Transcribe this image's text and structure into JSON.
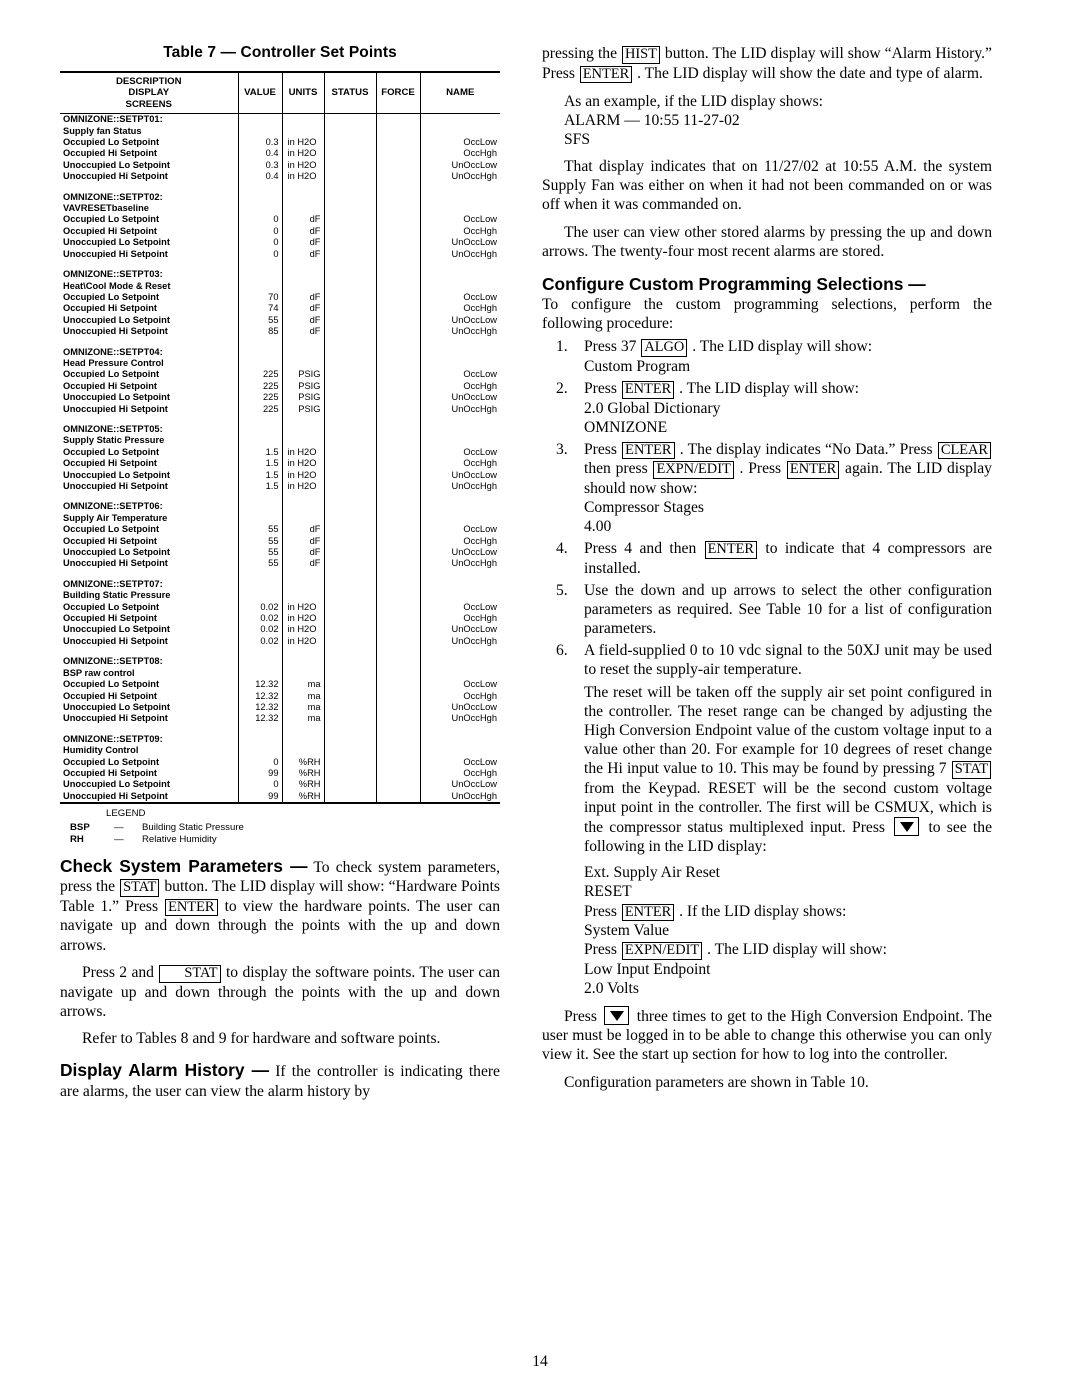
{
  "page": {
    "number": "14"
  },
  "table": {
    "title": "Table 7 — Controller Set Points",
    "headers": {
      "description": "DESCRIPTION\nDISPLAY\nSCREENS",
      "desc_line1": "DESCRIPTION",
      "desc_line2": "DISPLAY",
      "desc_line3": "SCREENS",
      "value": "VALUE",
      "units": "UNITS",
      "status": "STATUS",
      "force": "FORCE",
      "name": "NAME"
    },
    "groups": [
      {
        "id": "OMNIZONE::SETPT01:",
        "subtitle": "Supply fan Status",
        "rows": [
          {
            "desc": "Occupied Lo Setpoint",
            "value": "0.3",
            "units": "in H2O",
            "status": "",
            "force": "",
            "name": "OccLow"
          },
          {
            "desc": "Occupied Hi Setpoint",
            "value": "0.4",
            "units": "in H2O",
            "status": "",
            "force": "",
            "name": "OccHgh"
          },
          {
            "desc": "Unoccupied Lo Setpoint",
            "value": "0.3",
            "units": "in H2O",
            "status": "",
            "force": "",
            "name": "UnOccLow"
          },
          {
            "desc": "Unoccupied Hi Setpoint",
            "value": "0.4",
            "units": "in H2O",
            "status": "",
            "force": "",
            "name": "UnOccHgh"
          }
        ]
      },
      {
        "id": "OMNIZONE::SETPT02:",
        "subtitle": "VAVRESETbaseline",
        "rows": [
          {
            "desc": "Occupied Lo Setpoint",
            "value": "0",
            "units": "dF",
            "status": "",
            "force": "",
            "name": "OccLow"
          },
          {
            "desc": "Occupied Hi Setpoint",
            "value": "0",
            "units": "dF",
            "status": "",
            "force": "",
            "name": "OccHgh"
          },
          {
            "desc": "Unoccupied Lo Setpoint",
            "value": "0",
            "units": "dF",
            "status": "",
            "force": "",
            "name": "UnOccLow"
          },
          {
            "desc": "Unoccupied Hi Setpoint",
            "value": "0",
            "units": "dF",
            "status": "",
            "force": "",
            "name": "UnOccHgh"
          }
        ]
      },
      {
        "id": "OMNIZONE::SETPT03:",
        "subtitle": "Heat\\Cool Mode & Reset",
        "rows": [
          {
            "desc": "Occupied Lo Setpoint",
            "value": "70",
            "units": "dF",
            "status": "",
            "force": "",
            "name": "OccLow"
          },
          {
            "desc": "Occupied Hi Setpoint",
            "value": "74",
            "units": "dF",
            "status": "",
            "force": "",
            "name": "OccHgh"
          },
          {
            "desc": "Unoccupied Lo Setpoint",
            "value": "55",
            "units": "dF",
            "status": "",
            "force": "",
            "name": "UnOccLow"
          },
          {
            "desc": "Unoccupied Hi Setpoint",
            "value": "85",
            "units": "dF",
            "status": "",
            "force": "",
            "name": "UnOccHgh"
          }
        ]
      },
      {
        "id": "OMNIZONE::SETPT04:",
        "subtitle": "Head Pressure Control",
        "rows": [
          {
            "desc": "Occupied Lo Setpoint",
            "value": "225",
            "units": "PSIG",
            "status": "",
            "force": "",
            "name": "OccLow"
          },
          {
            "desc": "Occupied Hi Setpoint",
            "value": "225",
            "units": "PSIG",
            "status": "",
            "force": "",
            "name": "OccHgh"
          },
          {
            "desc": "Unoccupied Lo Setpoint",
            "value": "225",
            "units": "PSIG",
            "status": "",
            "force": "",
            "name": "UnOccLow"
          },
          {
            "desc": "Unoccupied Hi Setpoint",
            "value": "225",
            "units": "PSIG",
            "status": "",
            "force": "",
            "name": "UnOccHgh"
          }
        ]
      },
      {
        "id": "OMNIZONE::SETPT05:",
        "subtitle": "Supply Static Pressure",
        "rows": [
          {
            "desc": "Occupied Lo Setpoint",
            "value": "1.5",
            "units": "in H2O",
            "status": "",
            "force": "",
            "name": "OccLow"
          },
          {
            "desc": "Occupied Hi Setpoint",
            "value": "1.5",
            "units": "in H2O",
            "status": "",
            "force": "",
            "name": "OccHgh"
          },
          {
            "desc": "Unoccupied Lo Setpoint",
            "value": "1.5",
            "units": "in H2O",
            "status": "",
            "force": "",
            "name": "UnOccLow"
          },
          {
            "desc": "Unoccupied Hi Setpoint",
            "value": "1.5",
            "units": "in H2O",
            "status": "",
            "force": "",
            "name": "UnOccHgh"
          }
        ]
      },
      {
        "id": "OMNIZONE::SETPT06:",
        "subtitle": "Supply Air Temperature",
        "rows": [
          {
            "desc": "Occupied Lo Setpoint",
            "value": "55",
            "units": "dF",
            "status": "",
            "force": "",
            "name": "OccLow"
          },
          {
            "desc": "Occupied Hi Setpoint",
            "value": "55",
            "units": "dF",
            "status": "",
            "force": "",
            "name": "OccHgh"
          },
          {
            "desc": "Unoccupied Lo Setpoint",
            "value": "55",
            "units": "dF",
            "status": "",
            "force": "",
            "name": "UnOccLow"
          },
          {
            "desc": "Unoccupied Hi Setpoint",
            "value": "55",
            "units": "dF",
            "status": "",
            "force": "",
            "name": "UnOccHgh"
          }
        ]
      },
      {
        "id": "OMNIZONE::SETPT07:",
        "subtitle": "Building Static Pressure",
        "rows": [
          {
            "desc": "Occupied Lo Setpoint",
            "value": "0.02",
            "units": "in H2O",
            "status": "",
            "force": "",
            "name": "OccLow"
          },
          {
            "desc": "Occupied Hi Setpoint",
            "value": "0.02",
            "units": "in H2O",
            "status": "",
            "force": "",
            "name": "OccHgh"
          },
          {
            "desc": "Unoccupied Lo Setpoint",
            "value": "0.02",
            "units": "in H2O",
            "status": "",
            "force": "",
            "name": "UnOccLow"
          },
          {
            "desc": "Unoccupied Hi Setpoint",
            "value": "0.02",
            "units": "in H2O",
            "status": "",
            "force": "",
            "name": "UnOccHgh"
          }
        ]
      },
      {
        "id": "OMNIZONE::SETPT08:",
        "subtitle": "BSP raw control",
        "rows": [
          {
            "desc": "Occupied Lo Setpoint",
            "value": "12.32",
            "units": "ma",
            "status": "",
            "force": "",
            "name": "OccLow"
          },
          {
            "desc": "Occupied Hi Setpoint",
            "value": "12.32",
            "units": "ma",
            "status": "",
            "force": "",
            "name": "OccHgh"
          },
          {
            "desc": "Unoccupied Lo Setpoint",
            "value": "12.32",
            "units": "ma",
            "status": "",
            "force": "",
            "name": "UnOccLow"
          },
          {
            "desc": "Unoccupied Hi Setpoint",
            "value": "12.32",
            "units": "ma",
            "status": "",
            "force": "",
            "name": "UnOccHgh"
          }
        ]
      },
      {
        "id": "OMNIZONE::SETPT09:",
        "subtitle": "Humidity Control",
        "rows": [
          {
            "desc": "Occupied Lo Setpoint",
            "value": "0",
            "units": "%RH",
            "status": "",
            "force": "",
            "name": "OccLow"
          },
          {
            "desc": "Occupied Hi Setpoint",
            "value": "99",
            "units": "%RH",
            "status": "",
            "force": "",
            "name": "OccHgh"
          },
          {
            "desc": "Unoccupied Lo Setpoint",
            "value": "0",
            "units": "%RH",
            "status": "",
            "force": "",
            "name": "UnOccLow"
          },
          {
            "desc": "Unoccupied Hi Setpoint",
            "value": "99",
            "units": "%RH",
            "status": "",
            "force": "",
            "name": "UnOccHgh"
          }
        ]
      }
    ],
    "legend": {
      "title": "LEGEND",
      "entries": [
        {
          "abbr": "BSP",
          "dash": "—",
          "definition": "Building Static Pressure"
        },
        {
          "abbr": "RH",
          "dash": "—",
          "definition": "Relative Humidity"
        }
      ]
    }
  },
  "left_column": {
    "check_params": {
      "heading": "Check System Parameters —",
      "p1_a": "To check system parameters, press the",
      "key1": "STAT",
      "p1_b": "button. The LID display will show: “Hardware Points Table 1.” Press",
      "key2": "ENTER",
      "p1_c": "to view the hardware points. The user can navigate up and down through the points with the up and down arrows.",
      "p2_a": "Press 2 and",
      "key3": "STAT",
      "p2_b": "to display the software points. The user can navigate up and down through the points with the up and down arrows.",
      "p3": "Refer to Tables 8 and 9 for hardware and software points."
    },
    "alarm_history": {
      "heading": "Display Alarm History —",
      "p1": "If the controller is indicating there are alarms, the user can view the alarm history by"
    }
  },
  "right_column": {
    "alarm_cont": {
      "p1_a": "pressing the",
      "key1": "HIST",
      "p1_b": "button. The LID display will show “Alarm History.” Press",
      "key2": "ENTER",
      "p1_c": ". The LID display will show the date and type of alarm.",
      "p2": "As an example, if the LID display shows:",
      "lid1": "ALARM — 10:55 11-27-02",
      "lid2": "SFS",
      "p3": "That display indicates that on 11/27/02 at 10:55 A.M. the system Supply Fan was either on when it had not been commanded on or was off when it was commanded on.",
      "p4": "The user can view other stored alarms by pressing the up and down arrows. The twenty-four most recent alarms are stored."
    },
    "configure": {
      "heading": "Configure Custom Programming Selections —",
      "intro": "To configure the custom programming selections, perform the following procedure:",
      "steps": [
        {
          "a": "Press 37",
          "key": "ALGO",
          "b": ". The LID display will show:",
          "lid": [
            "Custom Program"
          ]
        },
        {
          "a": "Press",
          "key": "ENTER",
          "b": ". The LID display will show:",
          "lid": [
            "2.0 Global Dictionary",
            "OMNIZONE"
          ]
        },
        {
          "a": "Press",
          "key": "ENTER",
          "b": ". The display indicates “No Data.” Press",
          "key2": "CLEAR",
          "c": "then press",
          "key3": "EXPN/EDIT",
          "d": ". Press",
          "key4": "ENTER",
          "e": "again. The LID display should now show:",
          "lid": [
            "Compressor Stages",
            "4.00"
          ]
        },
        {
          "a": "Press 4 and then",
          "key": "ENTER",
          "b": "to indicate that 4 compressors are installed.",
          "lid": []
        },
        {
          "a": "Use the down and up arrows to select the other configuration parameters as required. See Table 10 for a list of configuration parameters.",
          "lid": []
        },
        {
          "a": "A field-supplied 0 to 10 vdc signal to the 50XJ unit may be used to reset the supply-air temperature.",
          "lid": []
        }
      ],
      "reset_p1_a": "The reset will be taken off the supply air set point configured in the controller. The reset range can be changed by adjusting the High Conversion Endpoint value of the custom voltage input to a value other than 20. For example for 10 degrees of reset change the Hi input value to 10. This may be found by pressing 7",
      "reset_key1": "STAT",
      "reset_p1_b": "from the Keypad. RESET will be the second custom voltage input point in the controller. The first will be CSMUX, which is the compressor status multiplexed input. Press",
      "reset_arrow": "down-arrow",
      "reset_p1_c": "to see the following in the LID display:",
      "lid3": "Ext. Supply Air Reset",
      "lid4": "RESET",
      "press_enter_a": "Press",
      "press_enter_key": "ENTER",
      "press_enter_b": ". If the LID display shows:",
      "lid5": "System Value",
      "press_expn_a": "Press",
      "press_expn_key": "EXPN/EDIT",
      "press_expn_b": ". The LID display will show:",
      "lid6": "Low Input Endpoint",
      "lid7": "2.0 Volts",
      "final_a": "Press",
      "final_b": "three times to get to the High Conversion Endpoint. The user must be logged in to be able to change this otherwise you can only view it. See the start up section for how to log into the controller.",
      "closing": "Configuration parameters are shown in Table 10."
    }
  }
}
